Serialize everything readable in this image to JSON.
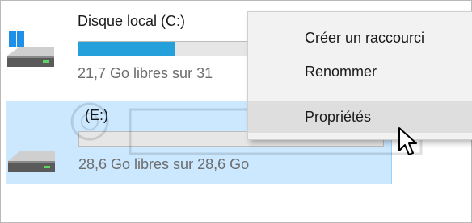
{
  "drives": [
    {
      "name": "Disque local (C:)",
      "free_text": "21,7 Go libres sur 31",
      "used_fraction": 0.3,
      "icon": "hard-drive-windows-icon"
    },
    {
      "name": "(E:)",
      "free_text": "28,6 Go libres sur 28,6 Go",
      "used_fraction": 0.0,
      "icon": "hard-drive-icon"
    }
  ],
  "context_menu": {
    "items": [
      {
        "label": "Créer un raccourci"
      },
      {
        "label": "Renommer"
      },
      {
        "label": "Propriétés",
        "highlighted": true
      }
    ]
  },
  "colors": {
    "selection_background": "#cce8ff",
    "selection_border": "#99d1ff",
    "capacity_fill": "#26a0da",
    "menu_background": "#f2f2f2",
    "menu_hover": "#dedede"
  },
  "cursor": {
    "icon": "arrow-cursor-icon"
  }
}
